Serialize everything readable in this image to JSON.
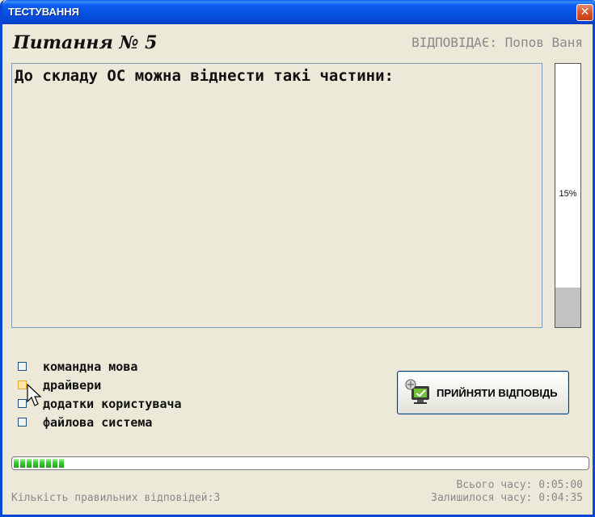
{
  "window": {
    "title": "ТЕСТУВАННЯ",
    "close_glyph": "✕"
  },
  "header": {
    "question_title": "Питання № 5",
    "student": "ВІДПОВІДАЄ: Попов Ваня"
  },
  "question": {
    "text": "До складу ОС можна віднести такі частини:"
  },
  "side_progress": {
    "label": "15%",
    "percent": 15,
    "fill_color": "#c2c2c2"
  },
  "options": [
    {
      "label": "командна мова",
      "checked": false
    },
    {
      "label": "драйвери",
      "checked": false,
      "hovered": true
    },
    {
      "label": "додатки користувача",
      "checked": false
    },
    {
      "label": "файлова система",
      "checked": false
    }
  ],
  "accept_button": {
    "label": "ПРИЙНЯТИ ВІДПОВІДЬ",
    "icon": "computer-accept-icon"
  },
  "time_progress": {
    "filled_segments": 8,
    "color": "#2fce2f"
  },
  "footer": {
    "correct_answers": "Кількість правильних відповідей:3",
    "total_time": "Всього часу: 0:05:00",
    "remaining_time": "Залишилося часу: 0:04:35"
  }
}
